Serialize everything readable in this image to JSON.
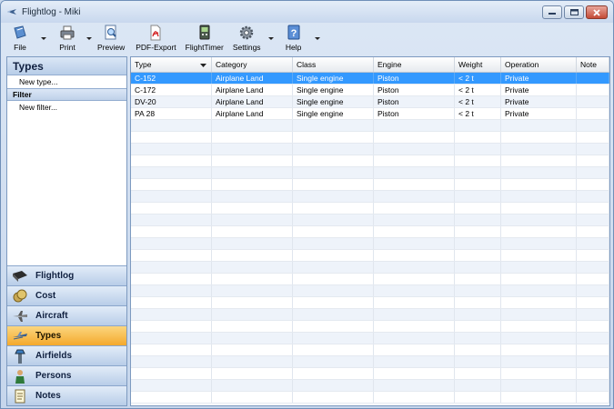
{
  "window": {
    "title": "Flightlog - Miki"
  },
  "toolbar": {
    "items": [
      {
        "label": "File",
        "icon": "file-icon"
      },
      {
        "label": "Print",
        "icon": "print-icon"
      },
      {
        "label": "Preview",
        "icon": "preview-icon"
      },
      {
        "label": "PDF-Export",
        "icon": "pdf-icon"
      },
      {
        "label": "FlightTimer",
        "icon": "flighttimer-icon"
      },
      {
        "label": "Settings",
        "icon": "gear-icon"
      },
      {
        "label": "Help",
        "icon": "help-icon"
      }
    ]
  },
  "sidebar": {
    "title": "Types",
    "new_type": "New type...",
    "filter_title": "Filter",
    "new_filter": "New filter...",
    "nav": [
      {
        "label": "Flightlog",
        "icon": "logbook-icon",
        "active": false
      },
      {
        "label": "Cost",
        "icon": "cost-icon",
        "active": false
      },
      {
        "label": "Aircraft",
        "icon": "aircraft-icon",
        "active": false
      },
      {
        "label": "Types",
        "icon": "types-icon",
        "active": true
      },
      {
        "label": "Airfields",
        "icon": "airfield-icon",
        "active": false
      },
      {
        "label": "Persons",
        "icon": "person-icon",
        "active": false
      },
      {
        "label": "Notes",
        "icon": "notes-icon",
        "active": false
      }
    ]
  },
  "grid": {
    "columns": [
      "Type",
      "Category",
      "Class",
      "Engine",
      "Weight",
      "Operation",
      "Note"
    ],
    "rows": [
      [
        "C-152",
        "Airplane Land",
        "Single engine",
        "Piston",
        "< 2 t",
        "Private",
        ""
      ],
      [
        "C-172",
        "Airplane Land",
        "Single engine",
        "Piston",
        "< 2 t",
        "Private",
        ""
      ],
      [
        "DV-20",
        "Airplane Land",
        "Single engine",
        "Piston",
        "< 2 t",
        "Private",
        ""
      ],
      [
        "PA 28",
        "Airplane Land",
        "Single engine",
        "Piston",
        "< 2 t",
        "Private",
        ""
      ]
    ],
    "selected_row": 0,
    "sorted_column": "Type"
  },
  "colors": {
    "selection": "#3399ff",
    "active_nav": "#f4a92c",
    "panel_border": "#7d9ac0"
  }
}
